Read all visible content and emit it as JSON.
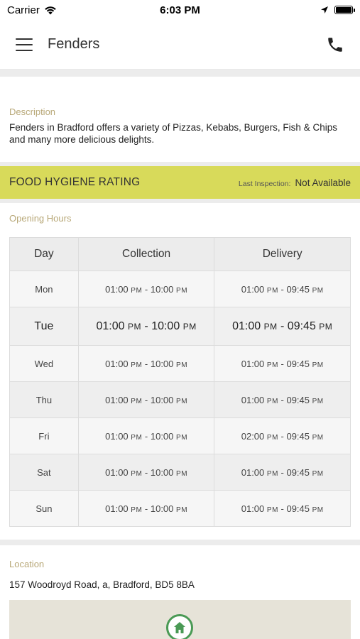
{
  "status_bar": {
    "carrier": "Carrier",
    "time": "6:03 PM"
  },
  "header": {
    "title": "Fenders"
  },
  "description": {
    "label": "Description",
    "text": "Fenders in Bradford offers a variety of Pizzas, Kebabs, Burgers, Fish & Chips and many more delicious delights."
  },
  "hygiene": {
    "title": "FOOD HYGIENE RATING",
    "inspection_label": "Last Inspection:",
    "inspection_value": "Not Available"
  },
  "opening_hours": {
    "label": "Opening Hours",
    "columns": [
      "Day",
      "Collection",
      "Delivery"
    ],
    "rows": [
      {
        "day": "Mon",
        "coll_start": "01:00",
        "coll_end": "10:00",
        "del_start": "01:00",
        "del_end": "09:45"
      },
      {
        "day": "Tue",
        "coll_start": "01:00",
        "coll_end": "10:00",
        "del_start": "01:00",
        "del_end": "09:45"
      },
      {
        "day": "Wed",
        "coll_start": "01:00",
        "coll_end": "10:00",
        "del_start": "01:00",
        "del_end": "09:45"
      },
      {
        "day": "Thu",
        "coll_start": "01:00",
        "coll_end": "10:00",
        "del_start": "01:00",
        "del_end": "09:45"
      },
      {
        "day": "Fri",
        "coll_start": "01:00",
        "coll_end": "10:00",
        "del_start": "02:00",
        "del_end": "09:45"
      },
      {
        "day": "Sat",
        "coll_start": "01:00",
        "coll_end": "10:00",
        "del_start": "01:00",
        "del_end": "09:45"
      },
      {
        "day": "Sun",
        "coll_start": "01:00",
        "coll_end": "10:00",
        "del_start": "01:00",
        "del_end": "09:45"
      }
    ],
    "pm": "PM",
    "highlighted_day": "Tue"
  },
  "location": {
    "label": "Location",
    "address": "157 Woodroyd Road, a, Bradford, BD5 8BA"
  },
  "icons": {
    "menu": "hamburger-menu-icon",
    "phone": "phone-icon",
    "wifi": "wifi-icon",
    "location_arrow": "location-arrow-icon",
    "battery": "battery-icon",
    "map_pin": "home-pin-icon"
  },
  "colors": {
    "hygiene_bar": "#d8da5a",
    "section_label": "#b8a878",
    "map_pin": "#4a9a55"
  }
}
